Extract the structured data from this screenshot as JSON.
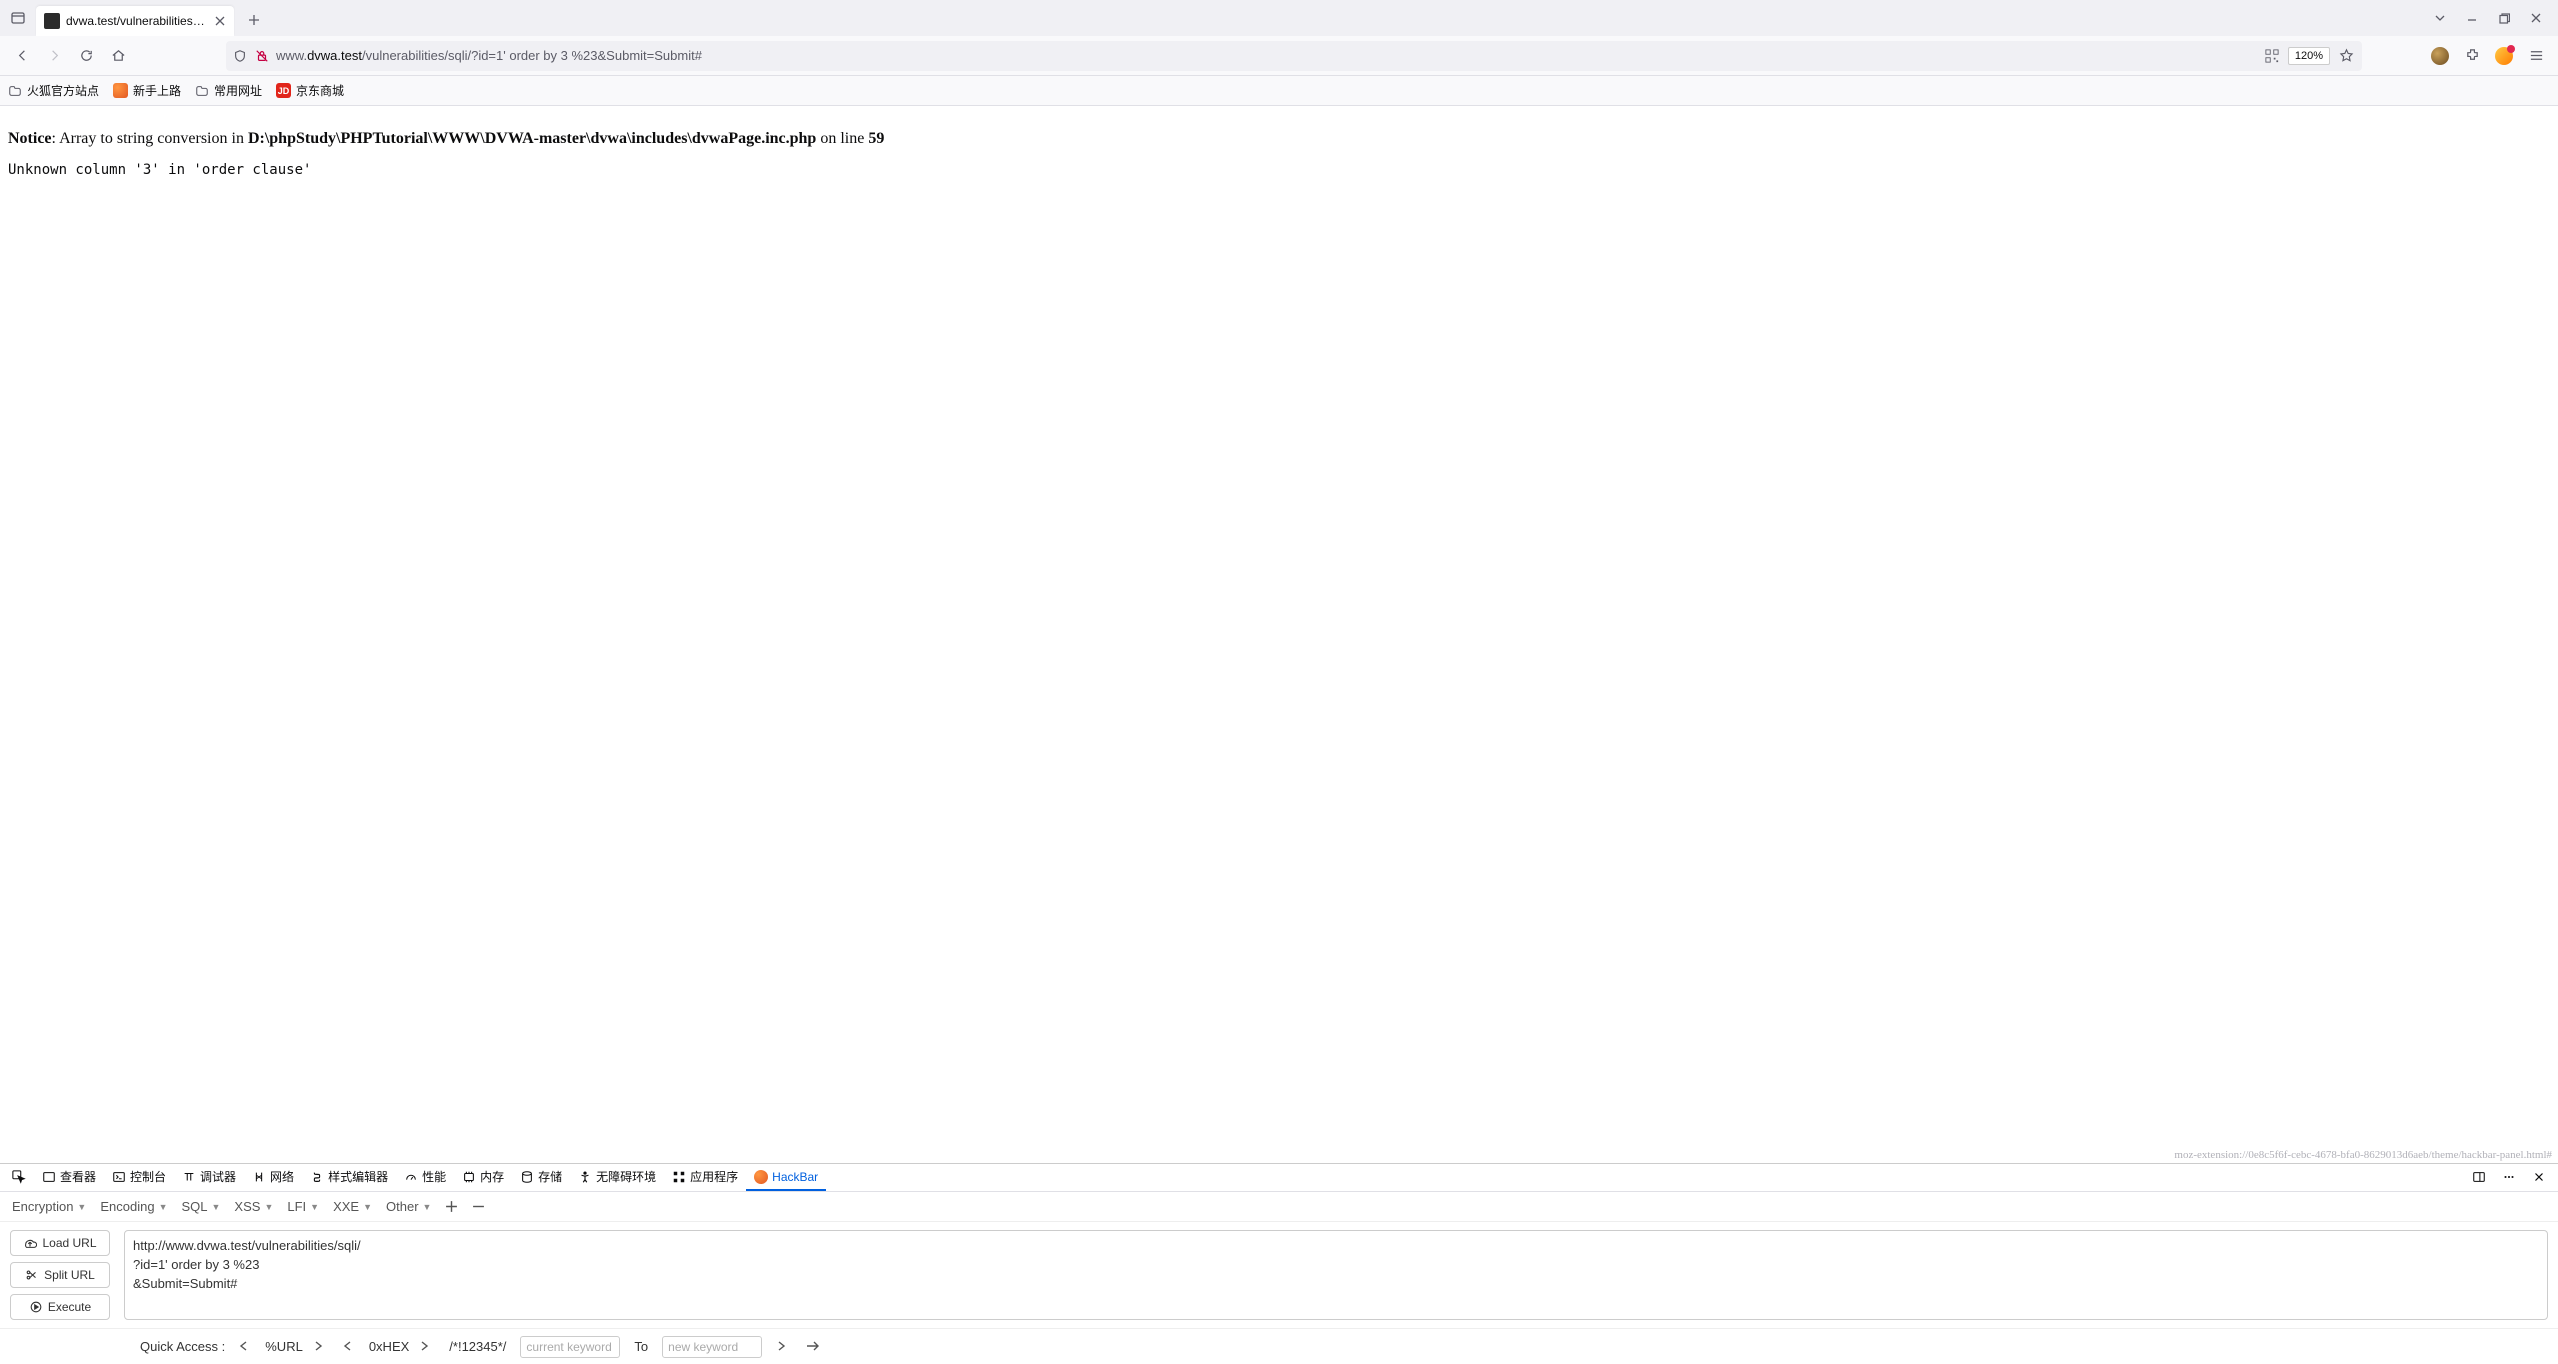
{
  "tab": {
    "title": "dvwa.test/vulnerabilities/sqli/"
  },
  "url": {
    "prefix": "www.",
    "domain": "dvwa.test",
    "path": "/vulnerabilities/sqli/?id=1' order by 3 %23&Submit=Submit#"
  },
  "zoom": "120%",
  "bookmarks": [
    "火狐官方站点",
    "新手上路",
    "常用网址",
    "京东商城"
  ],
  "page": {
    "notice_label": "Notice",
    "notice_text": ": Array to string conversion in ",
    "file": "D:\\phpStudy\\PHPTutorial\\WWW\\DVWA-master\\dvwa\\includes\\dvwaPage.inc.php",
    "online": " on line ",
    "line": "59",
    "error": "Unknown column '3' in 'order clause'",
    "moz_ext": "moz-extension://0e8c5f6f-cebc-4678-bfa0-8629013d6aeb/theme/hackbar-panel.html#"
  },
  "devtools_tabs": [
    "查看器",
    "控制台",
    "调试器",
    "网络",
    "样式编辑器",
    "性能",
    "内存",
    "存储",
    "无障碍环境",
    "应用程序",
    "HackBar"
  ],
  "hackbar": {
    "menus": [
      "Encryption",
      "Encoding",
      "SQL",
      "XSS",
      "LFI",
      "XXE",
      "Other"
    ],
    "buttons": {
      "load": "Load URL",
      "split": "Split URL",
      "execute": "Execute"
    },
    "url_lines": "http://www.dvwa.test/vulnerabilities/sqli/\n?id=1' order by 3 %23\n&Submit=Submit#",
    "quick": {
      "label": "Quick Access :",
      "url": "%URL",
      "hex": "0xHEX",
      "comment": "/*!12345*/",
      "current_ph": "current keyword",
      "to": "To",
      "new_ph": "new keyword"
    }
  }
}
